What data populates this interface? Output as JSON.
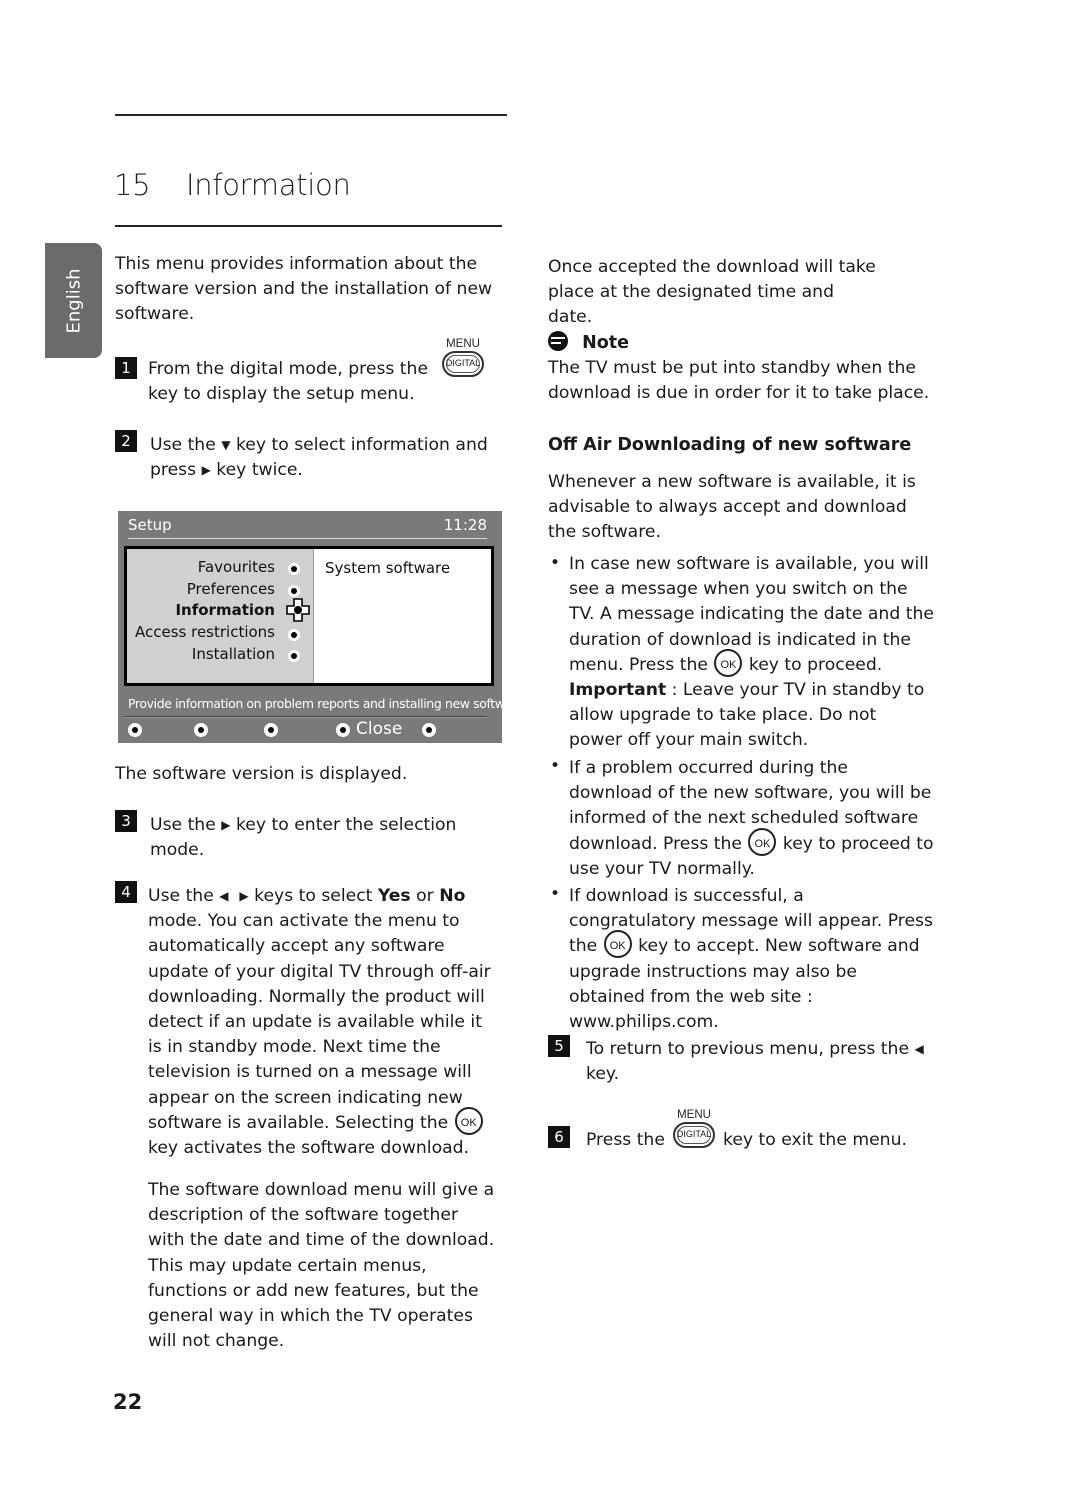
{
  "chapter": {
    "number": "15",
    "title": "Information"
  },
  "language_tab": "English",
  "left_column": {
    "intro": "This menu provides information about the software version and the installation of new software.",
    "steps": [
      {
        "num": "1",
        "text_before": "From the digital mode, press the",
        "text_after": "key to display the setup menu.",
        "key_label": "MENU",
        "key_text": "DIGITAL"
      },
      {
        "num": "2",
        "text_a": "Use the",
        "arrow_a": "▼",
        "text_b": "key to select information and press",
        "arrow_b": "▶",
        "text_c": "key twice."
      }
    ],
    "after_menu": "The software version is displayed.",
    "step3": {
      "num": "3",
      "text_a": "Use the",
      "arrow": "▶",
      "text_b": "key to enter the selection mode."
    },
    "step4": {
      "num": "4",
      "text_a": "Use the",
      "arrow_left": "◀",
      "arrow_right": "▶",
      "text_b": "keys to select",
      "yes": "Yes",
      "text_c": "or",
      "no": "No",
      "text_d": "mode. You can activate the menu to automatically accept any software update of your digital TV through off-air downloading. Normally the product will detect if an update is available while it is in standby mode. Next time the television is turned on a message will appear on the screen indicating new software is available. Selecting the",
      "ok": "OK",
      "text_e": "key activates the software download."
    },
    "step4_para2": "The software download menu will give a description of the software together with the date and time of the download. This may update certain menus, functions or add new features, but the general way in which the TV operates will not change."
  },
  "tv_menu": {
    "title": "Setup",
    "time": "11:28",
    "items": [
      {
        "label": "Favourites",
        "selected": false
      },
      {
        "label": "Preferences",
        "selected": false
      },
      {
        "label": "Information",
        "selected": true
      },
      {
        "label": "Access restrictions",
        "selected": false
      },
      {
        "label": "Installation",
        "selected": false
      }
    ],
    "right_panel": "System software",
    "description": "Provide information on problem reports and installing new software",
    "footer_close": "Close",
    "colors": {
      "frame": "#7a7a7a",
      "left_panel": "#d0d0d0",
      "right_panel": "#ffffff"
    }
  },
  "right_column": {
    "para1": "Once accepted the download will take place at the designated time and date.",
    "note_title": "Note",
    "note_text": "The TV must be put into standby when the download is due in order for it to take place.",
    "heading": "Off Air Downloading of new software",
    "para2": "Whenever a new software is available, it is advisable to always accept and download the software.",
    "bullets": [
      {
        "text_a": "In case new software is available, you will see a message when you switch on the TV. A message indicating the date and the duration of download is indicated in the menu. Press the",
        "ok": "OK",
        "text_b": "key to proceed.",
        "important": "Important",
        "text_c": ": Leave your TV in standby to allow upgrade to take place. Do not power off your main switch."
      },
      {
        "text_a": "If a problem occurred during the download of the new software, you will be informed of the next scheduled software download. Press the",
        "ok": "OK",
        "text_b": "key to proceed to use your TV normally."
      },
      {
        "text_a": "If download is successful, a congratulatory message will appear. Press the",
        "ok": "OK",
        "text_b": "key to accept. New software and upgrade instructions may also be obtained from the web site : www.philips.com."
      }
    ],
    "step5": {
      "num": "5",
      "text": "To return to previous menu, press the",
      "arrow": "◀",
      "text_b": "key."
    },
    "step6": {
      "num": "6",
      "text_a": "Press the",
      "key_label": "MENU",
      "key_text": "DIGITAL",
      "text_b": "key to exit the menu."
    }
  },
  "page_number": "22"
}
